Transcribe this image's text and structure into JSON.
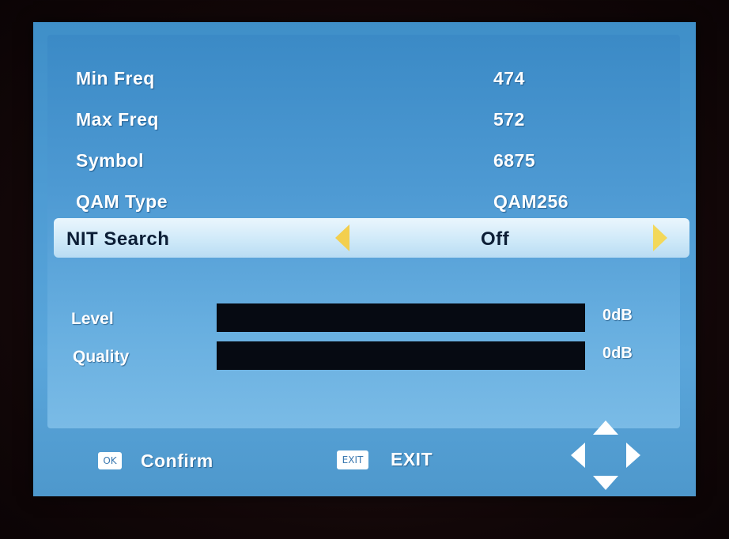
{
  "settings": {
    "rows": [
      {
        "label": "Min Freq",
        "value": "474"
      },
      {
        "label": "Max Freq",
        "value": "572"
      },
      {
        "label": "Symbol",
        "value": "6875"
      },
      {
        "label": "QAM Type",
        "value": "QAM256"
      },
      {
        "label": "NIT Search",
        "value": "Off",
        "selected": true
      }
    ]
  },
  "signal": {
    "level": {
      "label": "Level",
      "value": "0dB",
      "fraction": 0
    },
    "quality": {
      "label": "Quality",
      "value": "0dB",
      "fraction": 0
    }
  },
  "footer": {
    "ok_key": "OK",
    "confirm_label": "Confirm",
    "exit_key": "EXIT",
    "exit_label": "EXIT"
  },
  "icons": {
    "left_arrow": "left-arrow-icon",
    "right_arrow": "right-arrow-icon",
    "navigation": "dpad-navigation-icon"
  },
  "colors": {
    "panel_blue": "#4e9ad3",
    "selection": "#cde8f8",
    "arrow_yellow": "#f3cf4e",
    "meter_background": "#060a12"
  }
}
